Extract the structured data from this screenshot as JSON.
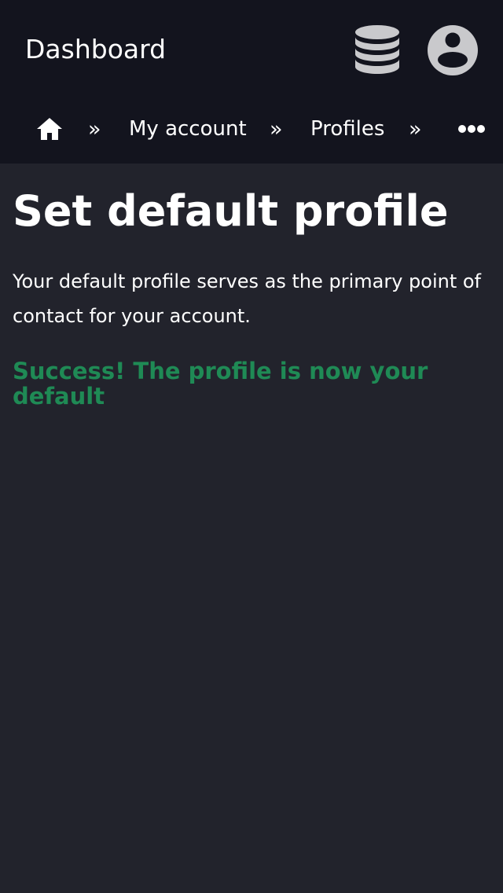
{
  "header": {
    "title": "Dashboard",
    "icons": {
      "database": "database-icon",
      "account": "user-circle-icon"
    }
  },
  "breadcrumb": {
    "home_icon": "home-icon",
    "separator": "»",
    "items": [
      "My account",
      "Profiles"
    ],
    "more_icon": "ellipsis-icon"
  },
  "main": {
    "title": "Set default profile",
    "description": "Your default profile serves as the primary point of contact for your account.",
    "success_message": "Success! The profile is now your default"
  },
  "colors": {
    "header_bg": "#13141e",
    "page_bg": "#22232c",
    "icon_gray": "#c9c9cc",
    "success": "#1f8a55"
  }
}
